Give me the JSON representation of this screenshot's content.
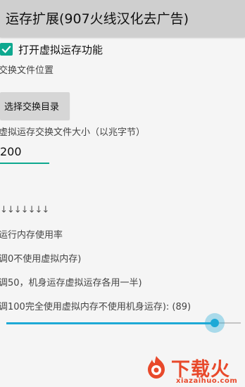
{
  "titlebar": {
    "title": "运存扩展(907火线汉化去广告)"
  },
  "enable_option": {
    "checked": true,
    "label": "打开虚拟运存功能"
  },
  "swap_location": {
    "label": "交换文件位置",
    "button_label": "选择交换目录"
  },
  "swap_size": {
    "label": "虚拟运存交换文件大小（以兆字节）",
    "value": "200"
  },
  "arrows_text": "↓↓↓↓↓↓↓",
  "swappiness": {
    "heading": "运行内存使用率",
    "desc_0": "调0不使用虚拟内存)",
    "desc_50": "调50，机身运存虚拟运存各用一半)",
    "desc_100": "调100完全使用虚拟内存不使用机身运存): (89)",
    "value": 89,
    "min": 0,
    "max": 100
  },
  "colors": {
    "accent_teal": "#0ea88f",
    "slider_blue": "#1ea9d6",
    "titlebar_bg": "#cfcfcf",
    "watermark_red": "#e8492b"
  },
  "watermark": {
    "text": "下载火",
    "url": "xiazaihuo.com",
    "icon": "fire-logo-icon"
  }
}
